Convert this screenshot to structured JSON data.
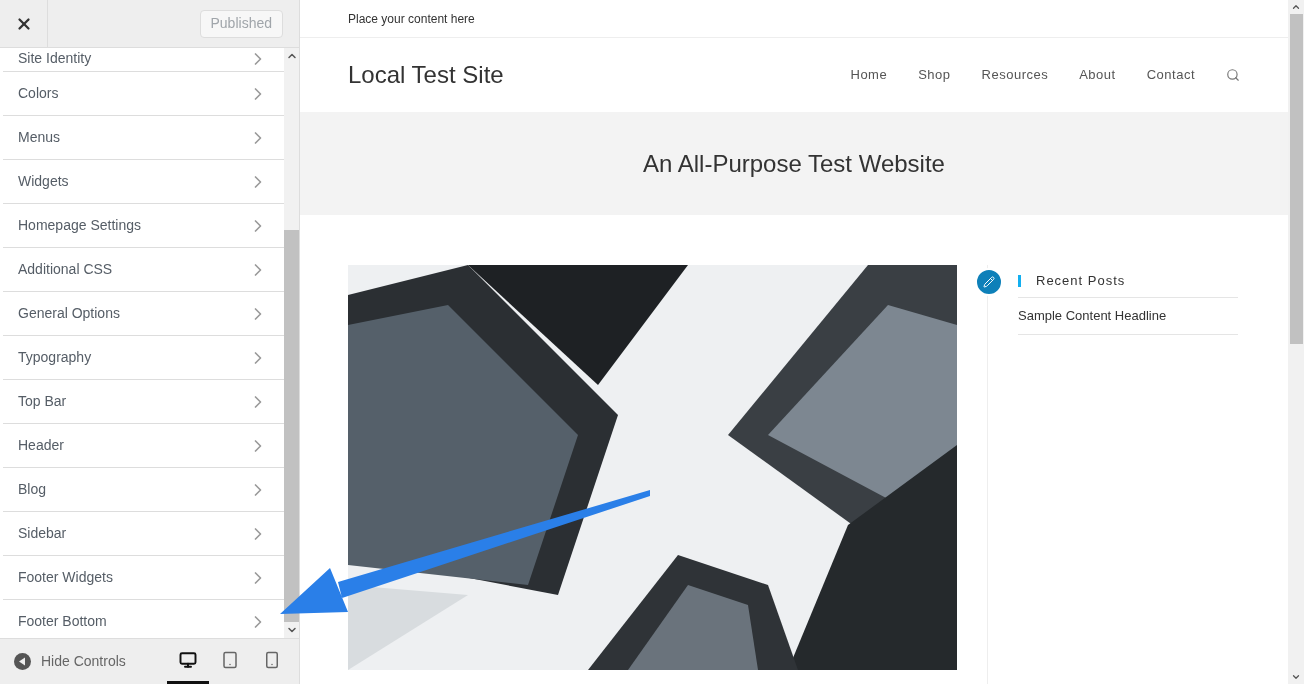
{
  "panel": {
    "publish_button": "Published",
    "sections": [
      {
        "label": "Site Identity"
      },
      {
        "label": "Colors"
      },
      {
        "label": "Menus"
      },
      {
        "label": "Widgets"
      },
      {
        "label": "Homepage Settings"
      },
      {
        "label": "Additional CSS"
      },
      {
        "label": "General Options"
      },
      {
        "label": "Typography"
      },
      {
        "label": "Top Bar"
      },
      {
        "label": "Header"
      },
      {
        "label": "Blog"
      },
      {
        "label": "Sidebar"
      },
      {
        "label": "Footer Widgets"
      },
      {
        "label": "Footer Bottom"
      }
    ],
    "hide_controls": "Hide Controls",
    "devices": [
      {
        "kind": "desktop",
        "selected": true
      },
      {
        "kind": "tablet",
        "selected": false
      },
      {
        "kind": "mobile",
        "selected": false
      }
    ]
  },
  "preview": {
    "top_bar": "Place your content here",
    "site_title": "Local Test Site",
    "nav": [
      "Home",
      "Shop",
      "Resources",
      "About",
      "Contact"
    ],
    "hero_title": "An All-Purpose Test Website",
    "sidebar": {
      "widget_title": "Recent Posts",
      "posts": [
        "Sample Content Headline"
      ]
    }
  }
}
